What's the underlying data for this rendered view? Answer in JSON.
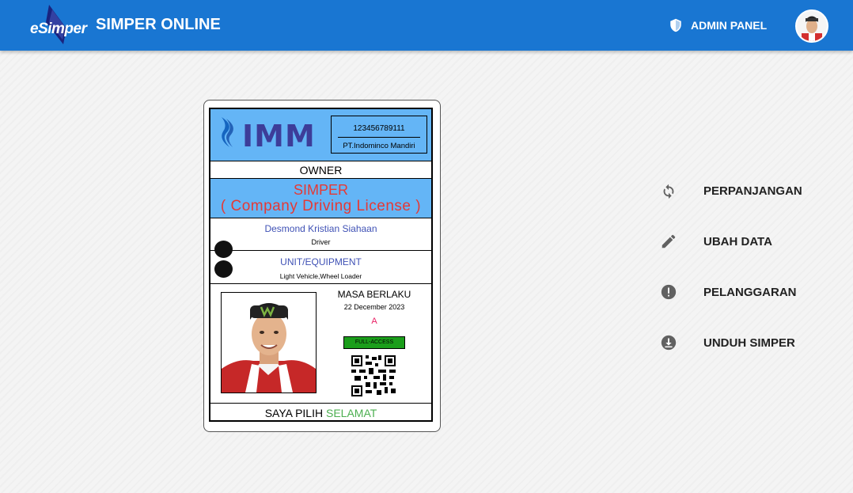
{
  "topbar": {
    "logo_text": "eSimper",
    "app_title": "SIMPER ONLINE",
    "admin_label": "ADMIN PANEL"
  },
  "card": {
    "company_logo_text": "IMM",
    "id_number": "123456789111",
    "company_name": "PT.Indominco Mandiri",
    "owner_label": "OWNER",
    "simper_title": "SIMPER",
    "simper_subtitle": "( Company Driving License )",
    "holder_name": "Desmond Kristian Siahaan",
    "holder_role": "Driver",
    "unit_label": "UNIT/EQUIPMENT",
    "unit_value": "Light Vehicle,Wheel Loader",
    "valid_label": "MASA BERLAKU",
    "valid_date": "22 December 2023",
    "grade": "A",
    "access_badge": "FULL-ACCESS",
    "footer_text": "SAYA PILIH",
    "footer_highlight": "SELAMAT"
  },
  "menu": {
    "items": [
      {
        "label": "PERPANJANGAN",
        "icon": "refresh-icon"
      },
      {
        "label": "UBAH DATA",
        "icon": "pencil-icon"
      },
      {
        "label": "PELANGGARAN",
        "icon": "alert-circle-icon"
      },
      {
        "label": "UNDUH SIMPER",
        "icon": "download-icon"
      }
    ]
  },
  "colors": {
    "topbar": "#1976d2",
    "card_blue": "#64b5f6",
    "simper_red": "#e53935",
    "name_blue": "#3f51b5",
    "access_green": "#1b9e1b",
    "safe_green": "#4caf50"
  }
}
